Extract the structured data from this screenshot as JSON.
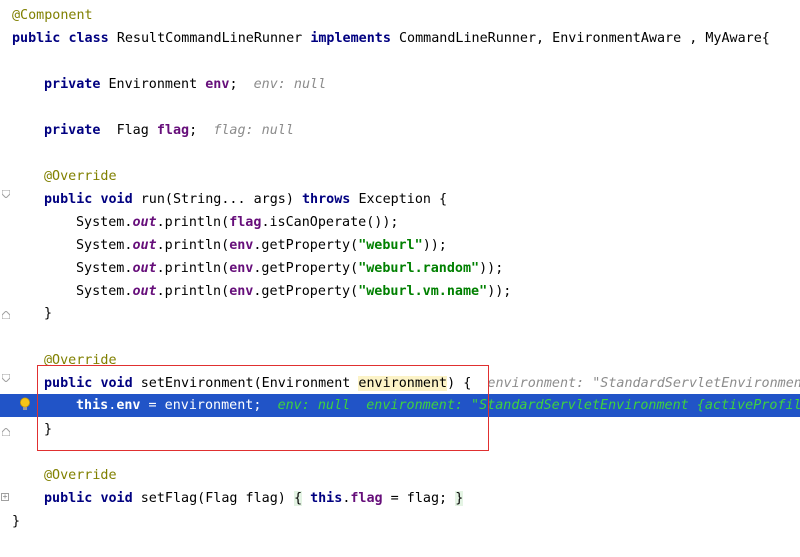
{
  "code": {
    "l1_ann": "@Component",
    "l2_public": "public",
    "l2_class": "class",
    "l2_name": "ResultCommandLineRunner",
    "l2_implements": "implements",
    "l2_rest": "CommandLineRunner, EnvironmentAware , MyAware{",
    "l4_private": "private",
    "l4_type": "Environment",
    "l4_field": "env",
    "l4_semi": ";",
    "l4_hint": "env: null",
    "l6_private": "private",
    "l6_type": "Flag",
    "l6_field": "flag",
    "l6_semi": ";",
    "l6_hint": "flag: null",
    "l8_ann": "@Override",
    "l9_public": "public",
    "l9_void": "void",
    "l9_sig": "run(String... args)",
    "l9_throws": "throws",
    "l9_rest": "Exception {",
    "l10_sys": "System.",
    "l10_out": "out",
    "l10_mid": ".println(",
    "l10_flag": "flag",
    "l10_end": ".isCanOperate());",
    "l11_sys": "System.",
    "l11_out": "out",
    "l11_mid": ".println(",
    "l11_env": "env",
    "l11_get": ".getProperty(",
    "l11_str": "\"weburl\"",
    "l11_end": "));",
    "l12_sys": "System.",
    "l12_out": "out",
    "l12_mid": ".println(",
    "l12_env": "env",
    "l12_get": ".getProperty(",
    "l12_str": "\"weburl.random\"",
    "l12_end": "));",
    "l13_sys": "System.",
    "l13_out": "out",
    "l13_mid": ".println(",
    "l13_env": "env",
    "l13_get": ".getProperty(",
    "l13_str": "\"weburl.vm.name\"",
    "l13_end": "));",
    "l14_close": "}",
    "l16_ann": "@Override",
    "l17_public": "public",
    "l17_void": "void",
    "l17_sig": "setEnvironment(Environment ",
    "l17_param": "environment",
    "l17_end": ") {",
    "l17_hint": "environment: \"StandardServletEnvironment",
    "l18_this": "this",
    "l18_dot": ".",
    "l18_env": "env",
    "l18_rest": " = environment;",
    "l18_dbg1": "env: null",
    "l18_dbg2": "environment: \"StandardServletEnvironment {activeProfil",
    "l19_close": "}",
    "l21_ann": "@Override",
    "l22_public": "public",
    "l22_void": "void",
    "l22_sig": "setFlag(Flag flag)",
    "l22_open": "{",
    "l22_this": "this",
    "l22_dot": ".",
    "l22_flag": "flag",
    "l22_rest": " = flag;",
    "l22_close": "}",
    "l23_close": "}"
  }
}
